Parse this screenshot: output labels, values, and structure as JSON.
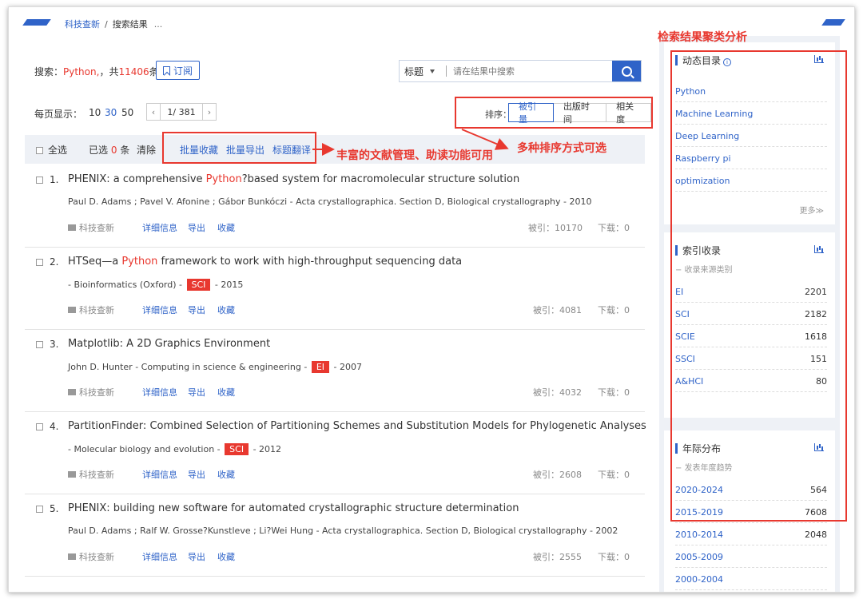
{
  "breadcrumb": {
    "home": "科技查新",
    "sep": "/",
    "current": "搜索结果",
    "ellipsis": "..."
  },
  "search": {
    "label": "搜索：",
    "query": "Python,",
    "count_prefix": "，共",
    "count": "11406",
    "count_suffix": "条",
    "subscribe": "订阅",
    "field": "标题",
    "placeholder": "请在结果中搜索"
  },
  "perpage": {
    "label": "每页显示：",
    "options": [
      "10",
      "30",
      "50"
    ],
    "active_index": 1,
    "page": "1/ 381"
  },
  "sort": {
    "label": "排序：",
    "options": [
      "被引量",
      "出版时间",
      "相关度"
    ],
    "active_index": 0
  },
  "toolbar": {
    "select_all": "全选",
    "selected_prefix": "已选",
    "selected_count": "0",
    "selected_suffix": "条",
    "clear": "清除",
    "batch": [
      "批量收藏",
      "批量导出",
      "标题翻译"
    ]
  },
  "annotations": {
    "batch_note": "丰富的文献管理、助读功能可用",
    "sort_note": "多种排序方式可选",
    "panel_note": "检索结果聚类分析"
  },
  "results": [
    {
      "num": "1.",
      "title_pre": "PHENIX: a comprehensive ",
      "title_hl": "Python",
      "title_post": "?based system for macromolecular structure solution",
      "meta_pre": "Paul D. Adams ; Pavel V. Afonine ; Gábor Bunkóczi - Acta crystallographica. Section D, Biological crystallography - 2010",
      "badge": "",
      "meta_post": "",
      "source": "科技查新",
      "detail": "详细信息",
      "export": "导出",
      "fav": "收藏",
      "cite": "被引：10170",
      "download": "下载：0"
    },
    {
      "num": "2.",
      "title_pre": "HTSeq—a ",
      "title_hl": "Python",
      "title_post": " framework to work with high-throughput sequencing data",
      "meta_pre": "- Bioinformatics (Oxford) -",
      "badge": "SCI",
      "meta_post": "- 2015",
      "source": "科技查新",
      "detail": "详细信息",
      "export": "导出",
      "fav": "收藏",
      "cite": "被引：4081",
      "download": "下载：0"
    },
    {
      "num": "3.",
      "title_pre": "Matplotlib: A 2D Graphics Environment",
      "title_hl": "",
      "title_post": "",
      "meta_pre": "John D. Hunter - Computing in science & engineering -",
      "badge": "EI",
      "meta_post": "- 2007",
      "source": "科技查新",
      "detail": "详细信息",
      "export": "导出",
      "fav": "收藏",
      "cite": "被引：4032",
      "download": "下载：0"
    },
    {
      "num": "4.",
      "title_pre": "PartitionFinder: Combined Selection of Partitioning Schemes and Substitution Models for Phylogenetic Analyses",
      "title_hl": "",
      "title_post": "",
      "meta_pre": "- Molecular biology and evolution -",
      "badge": "SCI",
      "meta_post": "- 2012",
      "source": "科技查新",
      "detail": "详细信息",
      "export": "导出",
      "fav": "收藏",
      "cite": "被引：2608",
      "download": "下载：0"
    },
    {
      "num": "5.",
      "title_pre": "PHENIX: building new software for automated crystallographic structure determination",
      "title_hl": "",
      "title_post": "",
      "meta_pre": "Paul D. Adams ; Ralf W. Grosse?Kunstleve ; Li?Wei Hung - Acta crystallographica. Section D, Biological crystallography - 2002",
      "badge": "",
      "meta_post": "",
      "source": "科技查新",
      "detail": "详细信息",
      "export": "导出",
      "fav": "收藏",
      "cite": "被引：2555",
      "download": "下载：0"
    }
  ],
  "panels": {
    "catalog": {
      "title": "动态目录",
      "items": [
        "Python",
        "Machine Learning",
        "Deep Learning",
        "Raspberry pi",
        "optimization"
      ],
      "more": "更多≫"
    },
    "index": {
      "title": "索引收录",
      "subtitle": "− 收录来源类别",
      "items": [
        {
          "label": "EI",
          "count": "2201"
        },
        {
          "label": "SCI",
          "count": "2182"
        },
        {
          "label": "SCIE",
          "count": "1618"
        },
        {
          "label": "SSCI",
          "count": "151"
        },
        {
          "label": "A&HCI",
          "count": "80"
        }
      ]
    },
    "years": {
      "title": "年际分布",
      "subtitle": "− 发表年度趋势",
      "items": [
        {
          "label": "2020-2024",
          "count": "564"
        },
        {
          "label": "2015-2019",
          "count": "7608"
        },
        {
          "label": "2010-2014",
          "count": "2048"
        },
        {
          "label": "2005-2009",
          "count": ""
        },
        {
          "label": "2000-2004",
          "count": ""
        }
      ]
    }
  },
  "colors": {
    "accent": "#2f63c8",
    "highlight": "#e8382f",
    "panel_bg": "#eef1f6"
  }
}
